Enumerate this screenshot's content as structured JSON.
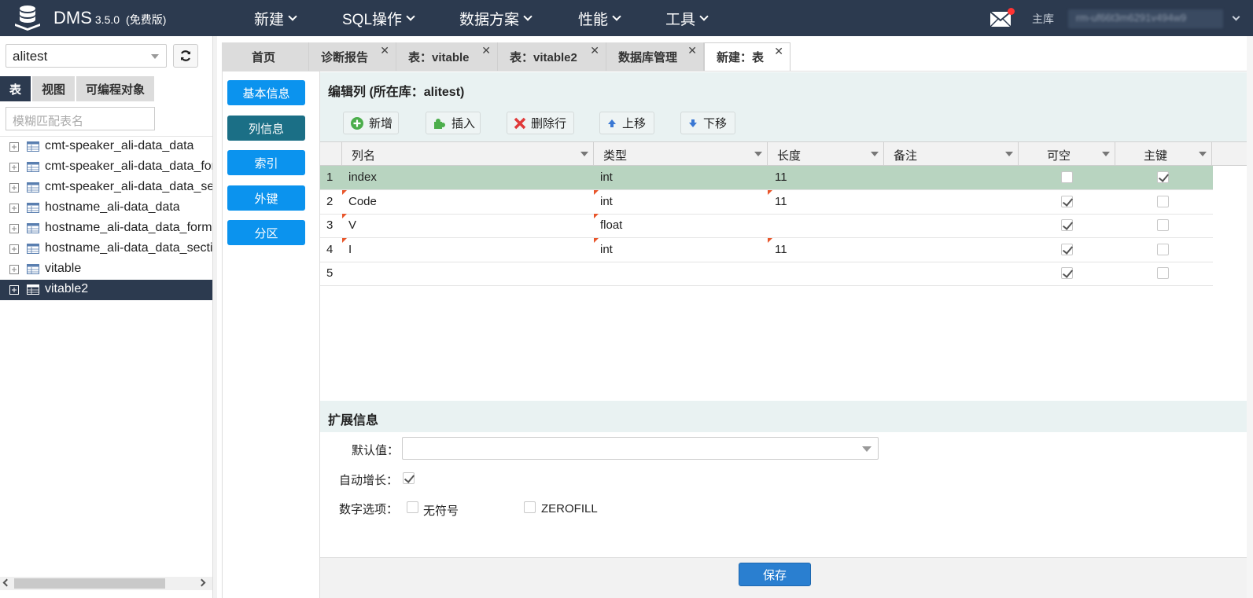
{
  "app": {
    "name": "DMS",
    "version": "3.5.0",
    "edition": "(免费版)"
  },
  "topnav": [
    {
      "label": "新建"
    },
    {
      "label": "SQL操作"
    },
    {
      "label": "数据方案"
    },
    {
      "label": "性能"
    },
    {
      "label": "工具"
    }
  ],
  "header": {
    "main_db_label": "主库",
    "instance": "rm-uf66t3m6291v494w9"
  },
  "left": {
    "db_value": "alitest",
    "tabs": [
      {
        "label": "表"
      },
      {
        "label": "视图"
      },
      {
        "label": "可编程对象"
      }
    ],
    "filter_placeholder": "模糊匹配表名",
    "tables": [
      {
        "label": "cmt-speaker_ali-data_data"
      },
      {
        "label": "cmt-speaker_ali-data_data_for"
      },
      {
        "label": "cmt-speaker_ali-data_data_sec"
      },
      {
        "label": "hostname_ali-data_data"
      },
      {
        "label": "hostname_ali-data_data_forma"
      },
      {
        "label": "hostname_ali-data_data_sectic"
      },
      {
        "label": "vitable"
      },
      {
        "label": "vitable2"
      }
    ],
    "selected_table": "vitable2"
  },
  "tabs": [
    {
      "label": "首页",
      "closable": false
    },
    {
      "label": "诊断报告",
      "closable": true
    },
    {
      "label": "表：vitable",
      "closable": true
    },
    {
      "label": "表：vitable2",
      "closable": true
    },
    {
      "label": "数据库管理",
      "closable": true
    },
    {
      "label": "新建：表",
      "closable": true,
      "active": true
    }
  ],
  "side_buttons": [
    {
      "label": "基本信息"
    },
    {
      "label": "列信息",
      "active": true
    },
    {
      "label": "索引"
    },
    {
      "label": "外键"
    },
    {
      "label": "分区"
    }
  ],
  "columns_section": {
    "title": "编辑列 (所在库：alitest)",
    "toolbar": [
      {
        "label": "新增",
        "icon": "add-icon"
      },
      {
        "label": "插入",
        "icon": "insert-icon"
      },
      {
        "label": "删除行",
        "icon": "delete-icon"
      },
      {
        "label": "上移",
        "icon": "arrow-up-icon"
      },
      {
        "label": "下移",
        "icon": "arrow-down-icon"
      }
    ],
    "headers": [
      "列名",
      "类型",
      "长度",
      "备注",
      "可空",
      "主键"
    ],
    "rows": [
      {
        "num": "1",
        "name": "index",
        "type": "int",
        "length": "11",
        "comment": "",
        "nullable": false,
        "primary": true,
        "selected": true
      },
      {
        "num": "2",
        "name": "Code",
        "type": "int",
        "length": "11",
        "comment": "",
        "nullable": true,
        "primary": false
      },
      {
        "num": "3",
        "name": "V",
        "type": "float",
        "length": "",
        "comment": "",
        "nullable": true,
        "primary": false
      },
      {
        "num": "4",
        "name": "I",
        "type": "int",
        "length": "11",
        "comment": "",
        "nullable": true,
        "primary": false
      },
      {
        "num": "5",
        "name": "",
        "type": "",
        "length": "",
        "comment": "",
        "nullable": true,
        "primary": false
      }
    ]
  },
  "ext": {
    "title": "扩展信息",
    "default_label": "默认值：",
    "auto_inc_label": "自动增长：",
    "auto_inc": true,
    "numeric_label": "数字选项：",
    "unsigned_label": "无符号",
    "unsigned": false,
    "zerofill_label": "ZEROFILL",
    "zerofill": false
  },
  "save_label": "保存",
  "colors": {
    "topbar": "#2c3a4f",
    "primary": "#0b93ee",
    "active_side": "#1b6f86",
    "row_selected": "#b8d4c0"
  }
}
